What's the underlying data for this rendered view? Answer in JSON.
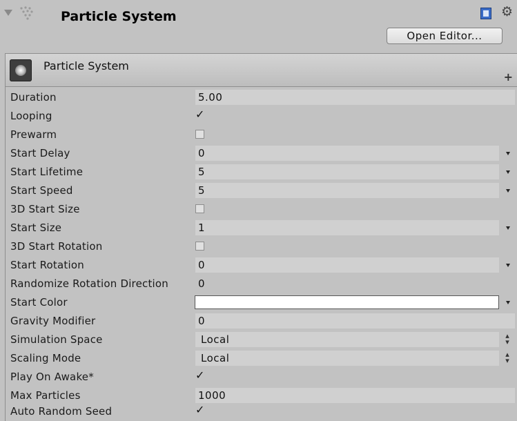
{
  "header": {
    "title": "Particle System",
    "open_editor_label": "Open Editor...",
    "icons": [
      "fold-arrow",
      "particle-system-icon",
      "help-book-icon",
      "settings-gear-icon"
    ]
  },
  "module": {
    "title": "Particle System",
    "add_label": "+"
  },
  "properties": [
    {
      "label": "Duration",
      "value": "5.00"
    },
    {
      "label": "Looping",
      "checked": true
    },
    {
      "label": "Prewarm",
      "checked": false
    },
    {
      "label": "Start Delay",
      "value": "0"
    },
    {
      "label": "Start Lifetime",
      "value": "5"
    },
    {
      "label": "Start Speed",
      "value": "5"
    },
    {
      "label": "3D Start Size",
      "checked": false
    },
    {
      "label": "Start Size",
      "value": "1"
    },
    {
      "label": "3D Start Rotation",
      "checked": false
    },
    {
      "label": "Start Rotation",
      "value": "0"
    },
    {
      "label": "Randomize Rotation Direction",
      "value": "0"
    },
    {
      "label": "Start Color",
      "color": "#ffffff"
    },
    {
      "label": "Gravity Modifier",
      "value": "0"
    },
    {
      "label": "Simulation Space",
      "value": "Local"
    },
    {
      "label": "Scaling Mode",
      "value": "Local"
    },
    {
      "label": "Play On Awake*",
      "checked": true
    },
    {
      "label": "Max Particles",
      "value": "1000"
    },
    {
      "label": "Auto Random Seed",
      "checked": true
    }
  ],
  "colors": {
    "background": "#c2c2c2",
    "field_background": "#d0d0d0",
    "help_icon": "#3b6cc7"
  }
}
